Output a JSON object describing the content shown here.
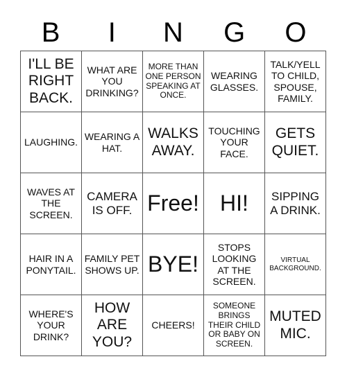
{
  "title_letters": [
    "B",
    "I",
    "N",
    "G",
    "O"
  ],
  "cells": [
    {
      "text": "I'LL BE RIGHT BACK.",
      "size": "s-l"
    },
    {
      "text": "WHAT ARE YOU DRINKING?",
      "size": "s-m"
    },
    {
      "text": "MORE THAN ONE PERSON SPEAKING AT ONCE.",
      "size": "s-s"
    },
    {
      "text": "WEARING GLASSES.",
      "size": "s-m"
    },
    {
      "text": "TALK/YELL TO CHILD, SPOUSE, FAMILY.",
      "size": "s-m"
    },
    {
      "text": "LAUGHING.",
      "size": "s-m"
    },
    {
      "text": "WEARING A HAT.",
      "size": "s-m"
    },
    {
      "text": "WALKS AWAY.",
      "size": "s-l"
    },
    {
      "text": "TOUCHING YOUR FACE.",
      "size": "s-m"
    },
    {
      "text": "GETS QUIET.",
      "size": "s-l"
    },
    {
      "text": "WAVES AT THE SCREEN.",
      "size": "s-m"
    },
    {
      "text": "CAMERA IS OFF.",
      "size": "s-ml"
    },
    {
      "text": "Free!",
      "size": "s-xl"
    },
    {
      "text": "HI!",
      "size": "s-xl"
    },
    {
      "text": "SIPPING A DRINK.",
      "size": "s-ml"
    },
    {
      "text": "HAIR IN A PONYTAIL.",
      "size": "s-m"
    },
    {
      "text": "FAMILY PET SHOWS UP.",
      "size": "s-m"
    },
    {
      "text": "BYE!",
      "size": "s-xl"
    },
    {
      "text": "STOPS LOOKING AT THE SCREEN.",
      "size": "s-m"
    },
    {
      "text": "VIRTUAL BACKGROUND.",
      "size": "s-xs"
    },
    {
      "text": "WHERE'S YOUR DRINK?",
      "size": "s-m"
    },
    {
      "text": "HOW ARE YOU?",
      "size": "s-l"
    },
    {
      "text": "CHEERS!",
      "size": "s-m"
    },
    {
      "text": "SOMEONE BRINGS THEIR CHILD OR BABY ON SCREEN.",
      "size": "s-s"
    },
    {
      "text": "MUTED MIC.",
      "size": "s-l"
    }
  ]
}
